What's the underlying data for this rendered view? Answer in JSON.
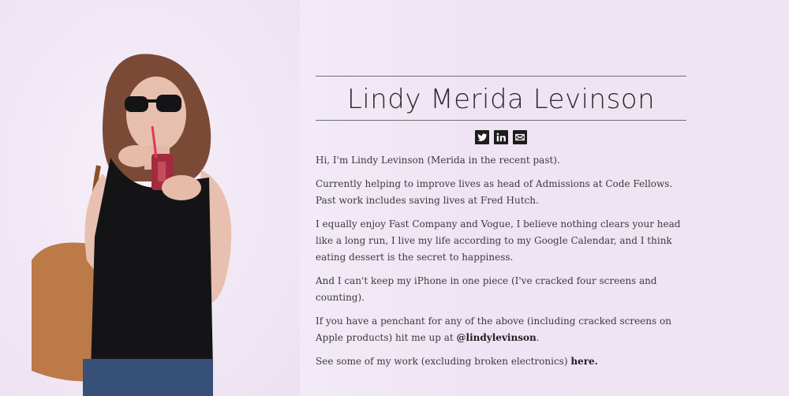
{
  "profile": {
    "name": "Lindy Merida Levinson"
  },
  "social": {
    "icons": [
      "twitter-icon",
      "linkedin-icon",
      "email-icon"
    ]
  },
  "bio": {
    "p1": "Hi, I'm Lindy Levinson (Merida in the recent past).",
    "p2": "Currently helping to improve lives as head of Admissions at Code Fellows. Past work includes saving lives at Fred Hutch.",
    "p3": "I equally enjoy Fast Company and Vogue, I believe nothing clears your head like a long run, I live my life according to my Google Calendar, and I think eating dessert is the secret to happiness.",
    "p4": "And I can't keep my iPhone in one piece (I've cracked four screens and counting).",
    "p5_prefix": "If you have a penchant for any of the above (including cracked screens on Apple products) hit me up at ",
    "p5_handle": "@lindylevinson",
    "p5_suffix": ".",
    "p6_prefix": "See some of my work (excluding broken electronics) ",
    "p6_link": "here.",
    "p6_suffix": ""
  },
  "colors": {
    "background": "#efe6f2",
    "text": "#3b3b3d",
    "accent": "#1d1d1f"
  }
}
